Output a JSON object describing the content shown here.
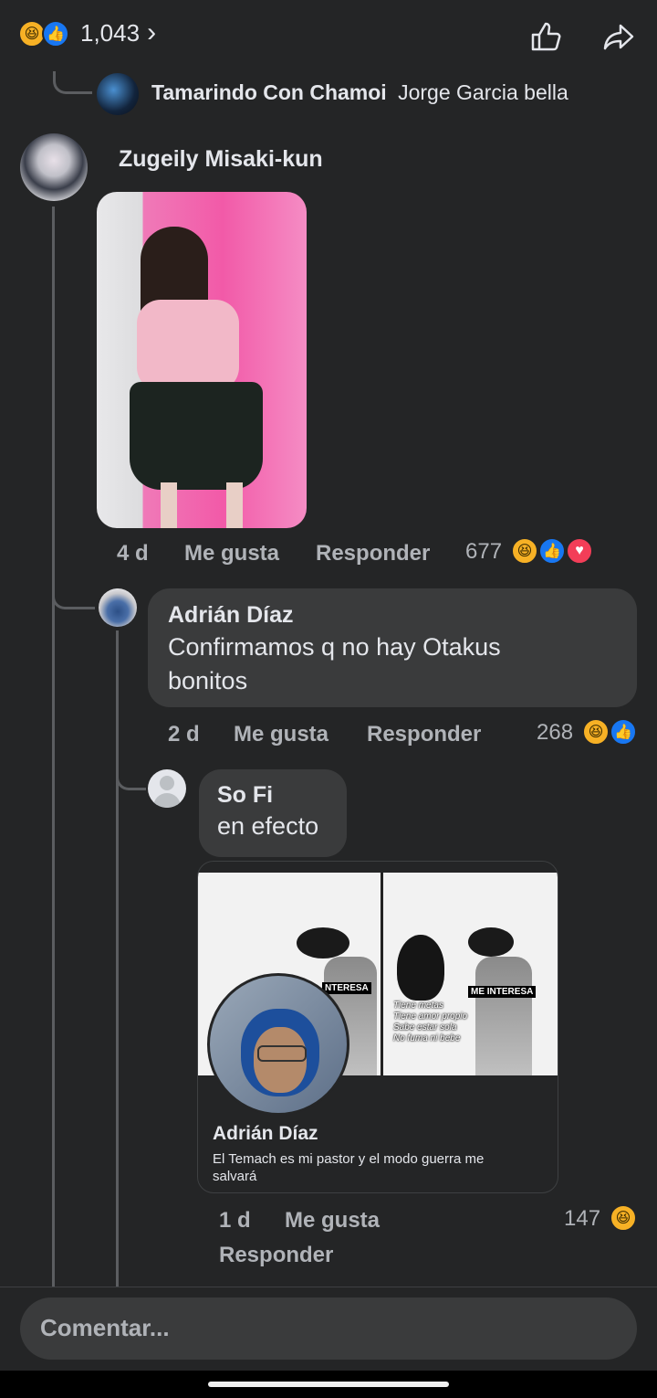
{
  "top_bar": {
    "reaction_count": "1,043"
  },
  "comments": {
    "reply_prev": {
      "author": "Tamarindo Con Chamoi",
      "text": "Jorge Garcia bella"
    },
    "c1": {
      "author": "Zugeily Misaki-kun",
      "time": "4 d",
      "like": "Me gusta",
      "reply": "Responder",
      "reactions": "677"
    },
    "c2": {
      "author": "Adrián Díaz",
      "text_line1": "Confirmamos q no hay Otakus",
      "text_line2": "bonitos",
      "time": "2 d",
      "like": "Me gusta",
      "reply": "Responder",
      "reactions": "268"
    },
    "c3": {
      "author": "So Fi",
      "text": "en efecto",
      "shared": {
        "meme_left_label": "NTERESA",
        "meme_right_label": "ME INTERESA",
        "meme_list": [
          "Tiene metas",
          "Tiene amor propio",
          "Sabe estar sola",
          "No fuma ni bebe"
        ],
        "author": "Adrián Díaz",
        "text": "El Temach es mi pastor y el modo guerra me salvará"
      },
      "time": "1 d",
      "like": "Me gusta",
      "reply": "Responder",
      "reactions": "147"
    }
  },
  "composer": {
    "placeholder": "Comentar..."
  },
  "colors": {
    "background": "#242526",
    "bubble": "#3a3b3c",
    "like_blue": "#1877f2",
    "haha_yellow": "#f7b125",
    "love_red": "#f33e58"
  }
}
